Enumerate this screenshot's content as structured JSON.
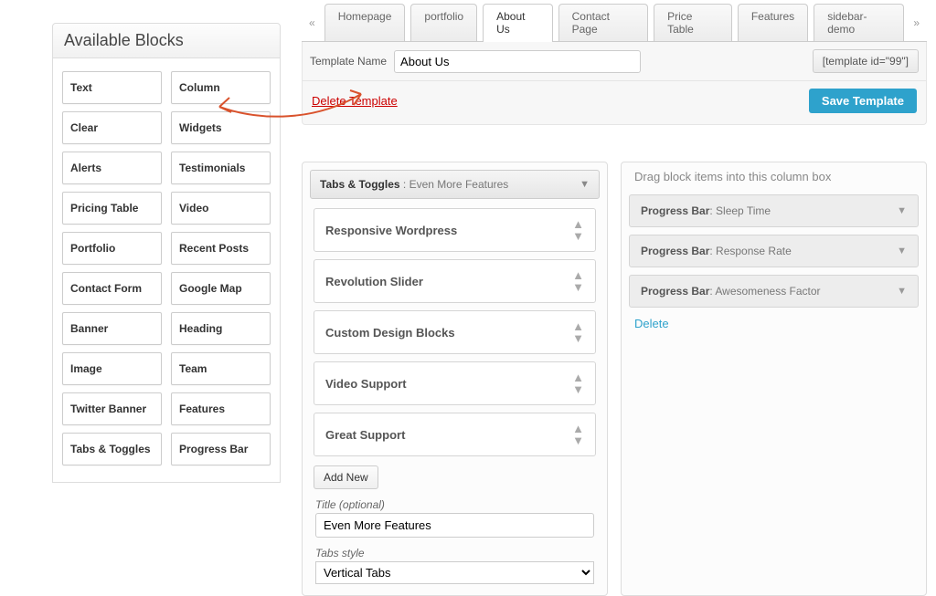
{
  "sidebar": {
    "title": "Available Blocks",
    "rows": [
      [
        "Text",
        "Column"
      ],
      [
        "Clear",
        "Widgets"
      ],
      [
        "Alerts",
        "Testimonials"
      ],
      [
        "Pricing Table",
        "Video"
      ],
      [
        "Portfolio",
        "Recent Posts"
      ],
      [
        "Contact Form",
        "Google Map"
      ],
      [
        "Banner",
        "Heading"
      ],
      [
        "Image",
        "Team"
      ],
      [
        "Twitter Banner",
        "Features"
      ],
      [
        "Tabs & Toggles",
        "Progress Bar"
      ]
    ]
  },
  "tabs": {
    "items": [
      "Homepage",
      "portfolio",
      "About Us",
      "Contact Page",
      "Price Table",
      "Features",
      "sidebar-demo"
    ],
    "active": 2
  },
  "template": {
    "label": "Template Name",
    "name": "About Us",
    "shortcode": "[template id=\"99\"]",
    "delete": "Delete Template",
    "save": "Save Template"
  },
  "main_module": {
    "type": "Tabs & Toggles",
    "subtitle": "Even More Features",
    "items": [
      "Responsive Wordpress",
      "Revolution Slider",
      "Custom Design Blocks",
      "Video Support",
      "Great Support"
    ],
    "add_new": "Add New",
    "title_label": "Title (optional)",
    "title_value": "Even More Features",
    "style_label": "Tabs style",
    "style_value": "Vertical Tabs"
  },
  "right_col": {
    "hint": "Drag block items into this column box",
    "items": [
      {
        "type": "Progress Bar",
        "sub": "Sleep Time"
      },
      {
        "type": "Progress Bar",
        "sub": "Response Rate"
      },
      {
        "type": "Progress Bar",
        "sub": "Awesomeness Factor"
      }
    ],
    "delete": "Delete"
  }
}
